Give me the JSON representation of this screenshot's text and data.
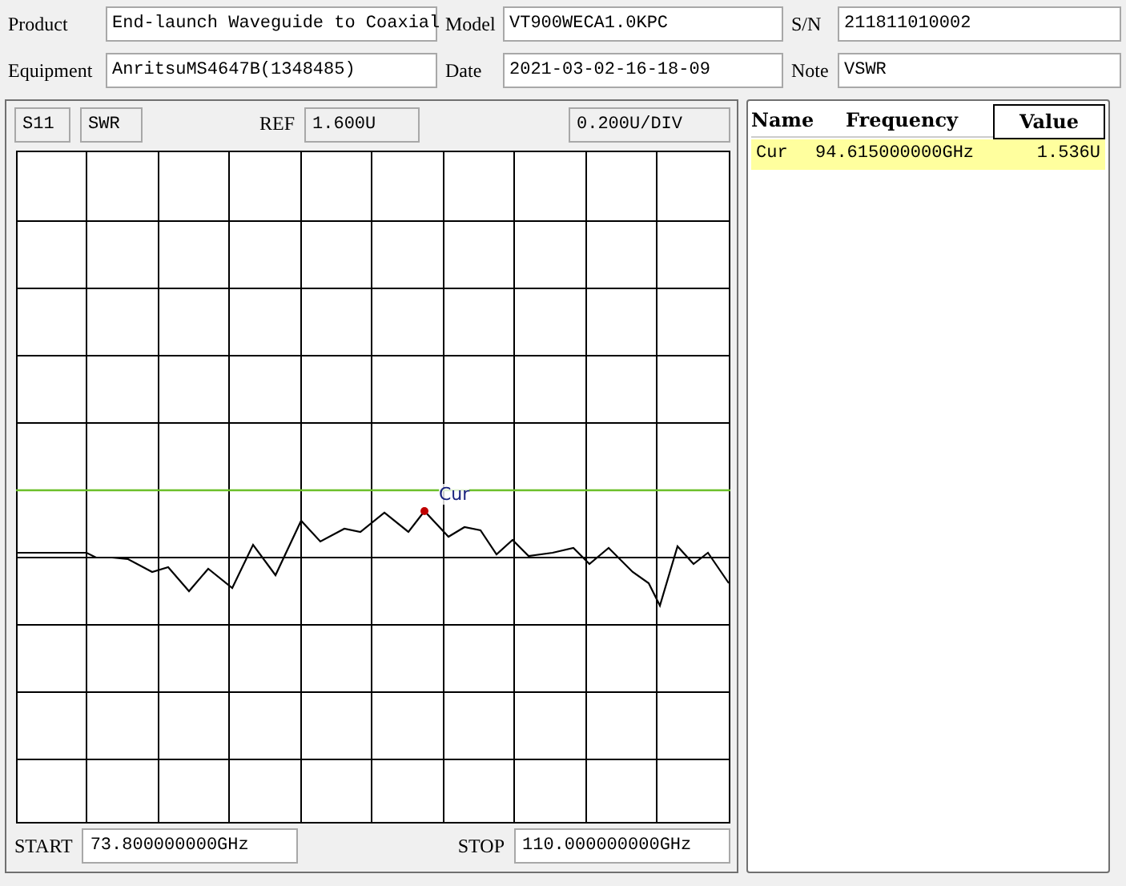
{
  "header": [
    {
      "label": "Product",
      "value": "End-launch Waveguide to Coaxial"
    },
    {
      "label": "Model",
      "value": "VT900WECA1.0KPC"
    },
    {
      "label": "S/N",
      "value": "211811010002"
    },
    {
      "label": "Equipment",
      "value": "AnritsuMS4647B(1348485)"
    },
    {
      "label": "Date",
      "value": "2021-03-02-16-18-09"
    },
    {
      "label": "Note",
      "value": "VSWR"
    }
  ],
  "trace_panel": {
    "parameter": "S11",
    "format": "SWR",
    "ref_label": "REF",
    "ref_value": "1.600U",
    "scale": "0.200U/DIV",
    "marker_label": "Cur",
    "start_label": "START",
    "start": "73.800000000GHz",
    "stop_label": "STOP",
    "stop": "110.000000000GHz"
  },
  "marker_table": {
    "columns": [
      "Name",
      "Frequency",
      "Value"
    ],
    "rows": [
      {
        "name": "Cur",
        "frequency": "94.615000000GHz",
        "value": "1.536U",
        "selected": true
      }
    ]
  }
}
